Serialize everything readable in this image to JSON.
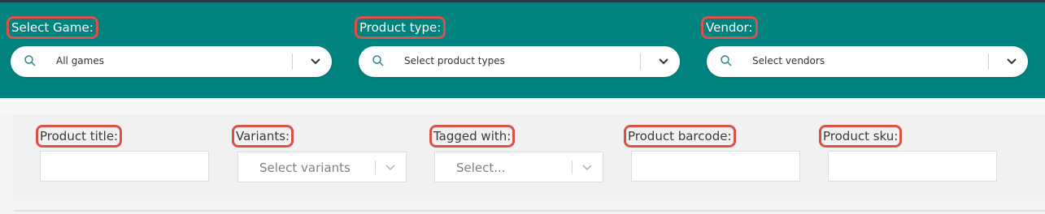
{
  "filters_top": [
    {
      "label": "Select Game:",
      "value": "All games"
    },
    {
      "label": "Product type:",
      "placeholder": "Select product types"
    },
    {
      "label": "Vendor:",
      "placeholder": "Select vendors"
    }
  ],
  "filters_bottom": [
    {
      "label": "Product title:",
      "value": ""
    },
    {
      "label": "Variants:",
      "placeholder": "Select variants"
    },
    {
      "label": "Tagged with:",
      "placeholder": "Select..."
    },
    {
      "label": "Product barcode:",
      "value": ""
    },
    {
      "label": "Product sku:",
      "value": ""
    }
  ],
  "icons": [
    "search-icon",
    "chevron-down-icon"
  ],
  "colors": {
    "header": "#00827e",
    "highlight": "#d9534b"
  }
}
